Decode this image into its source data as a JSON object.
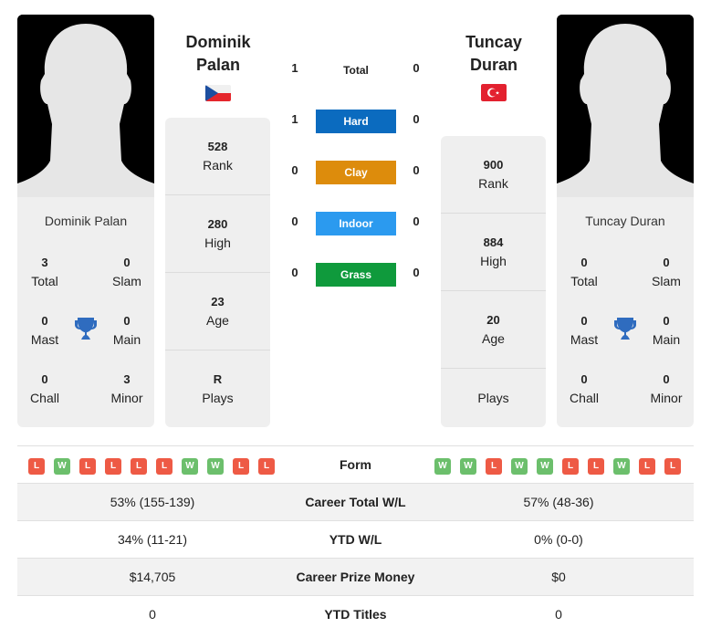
{
  "colors": {
    "hard": "#0b6bbf",
    "clay": "#dd8c0c",
    "indoor": "#2b9aef",
    "grass": "#0f9a3c",
    "win": "#6cbf6c",
    "loss": "#ee5a45",
    "trophy": "#2f6cbf"
  },
  "player1": {
    "name_line1": "Dominik",
    "name_line2": "Palan",
    "full_name": "Dominik Palan",
    "flag": "czech-republic",
    "photo": "silhouette-placeholder",
    "titles": {
      "total": {
        "value": "3",
        "label": "Total"
      },
      "slam": {
        "value": "0",
        "label": "Slam"
      },
      "mast": {
        "value": "0",
        "label": "Mast"
      },
      "main": {
        "value": "0",
        "label": "Main"
      },
      "chall": {
        "value": "0",
        "label": "Chall"
      },
      "minor": {
        "value": "3",
        "label": "Minor"
      }
    },
    "rank": {
      "value": "528",
      "label": "Rank"
    },
    "high": {
      "value": "280",
      "label": "High"
    },
    "age": {
      "value": "23",
      "label": "Age"
    },
    "plays": {
      "value": "R",
      "label": "Plays"
    },
    "form": [
      "L",
      "W",
      "L",
      "L",
      "L",
      "L",
      "W",
      "W",
      "L",
      "L"
    ]
  },
  "player2": {
    "name_line1": "Tuncay",
    "name_line2": "Duran",
    "full_name": "Tuncay Duran",
    "flag": "turkey",
    "photo": "silhouette-placeholder",
    "titles": {
      "total": {
        "value": "0",
        "label": "Total"
      },
      "slam": {
        "value": "0",
        "label": "Slam"
      },
      "mast": {
        "value": "0",
        "label": "Mast"
      },
      "main": {
        "value": "0",
        "label": "Main"
      },
      "chall": {
        "value": "0",
        "label": "Chall"
      },
      "minor": {
        "value": "0",
        "label": "Minor"
      }
    },
    "rank": {
      "value": "900",
      "label": "Rank"
    },
    "high": {
      "value": "884",
      "label": "High"
    },
    "age": {
      "value": "20",
      "label": "Age"
    },
    "plays": {
      "value": "",
      "label": "Plays"
    },
    "form": [
      "W",
      "W",
      "L",
      "W",
      "W",
      "L",
      "L",
      "W",
      "L",
      "L"
    ]
  },
  "h2h": [
    {
      "key": "total",
      "label": "Total",
      "p1": "1",
      "p2": "0"
    },
    {
      "key": "hard",
      "label": "Hard",
      "p1": "1",
      "p2": "0"
    },
    {
      "key": "clay",
      "label": "Clay",
      "p1": "0",
      "p2": "0"
    },
    {
      "key": "indoor",
      "label": "Indoor",
      "p1": "0",
      "p2": "0"
    },
    {
      "key": "grass",
      "label": "Grass",
      "p1": "0",
      "p2": "0"
    }
  ],
  "comparison": {
    "form_label": "Form",
    "rows": [
      {
        "label": "Career Total W/L",
        "p1": "53% (155-139)",
        "p2": "57% (48-36)"
      },
      {
        "label": "YTD W/L",
        "p1": "34% (11-21)",
        "p2": "0% (0-0)"
      },
      {
        "label": "Career Prize Money",
        "p1": "$14,705",
        "p2": "$0"
      },
      {
        "label": "YTD Titles",
        "p1": "0",
        "p2": "0"
      }
    ]
  }
}
